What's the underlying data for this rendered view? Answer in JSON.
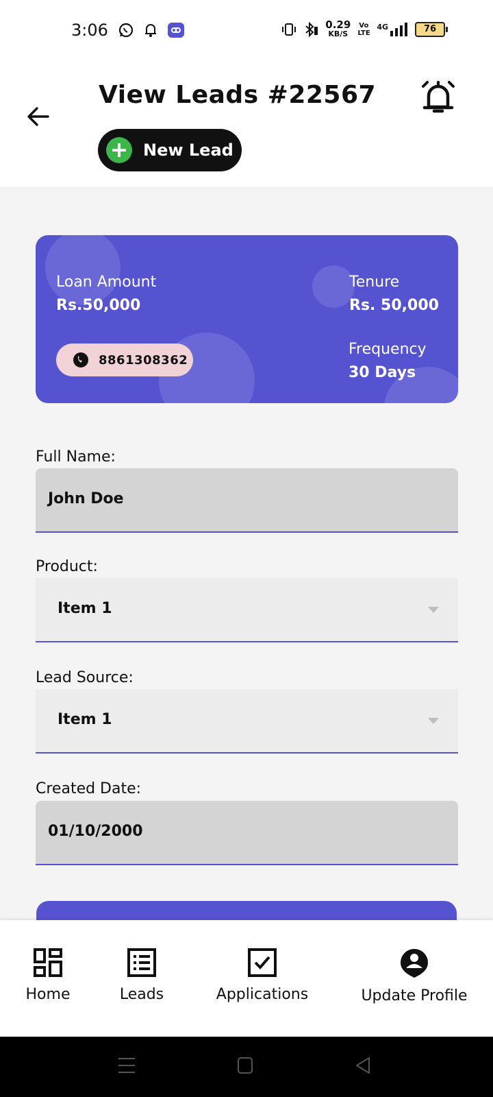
{
  "status_bar": {
    "time": "3:06",
    "net_speed_top": "0.29",
    "net_speed_bottom": "KB/S",
    "volte": "Vo LTE",
    "network": "4G",
    "battery": "76"
  },
  "header": {
    "title": "View Leads #22567",
    "new_lead_label": "New Lead"
  },
  "card": {
    "loan_amount_label": "Loan Amount",
    "loan_amount_value": "Rs.50,000",
    "tenure_label": "Tenure",
    "tenure_value": "Rs. 50,000",
    "frequency_label": "Frequency",
    "frequency_value": "30 Days",
    "phone": "8861308362",
    "accent": "#5653d1"
  },
  "form": {
    "full_name_label": "Full Name:",
    "full_name_value": "John Doe",
    "product_label": "Product:",
    "product_value": "Item 1",
    "lead_source_label": "Lead Source:",
    "lead_source_value": "Item 1",
    "created_date_label": "Created Date:",
    "created_date_value": "01/10/2000"
  },
  "bottom_nav": {
    "items": [
      {
        "label": "Home",
        "icon": "grid-icon"
      },
      {
        "label": "Leads",
        "icon": "list-icon"
      },
      {
        "label": "Applications",
        "icon": "checkbox-icon"
      },
      {
        "label": "Update Profile",
        "icon": "profile-pin-icon"
      }
    ]
  }
}
